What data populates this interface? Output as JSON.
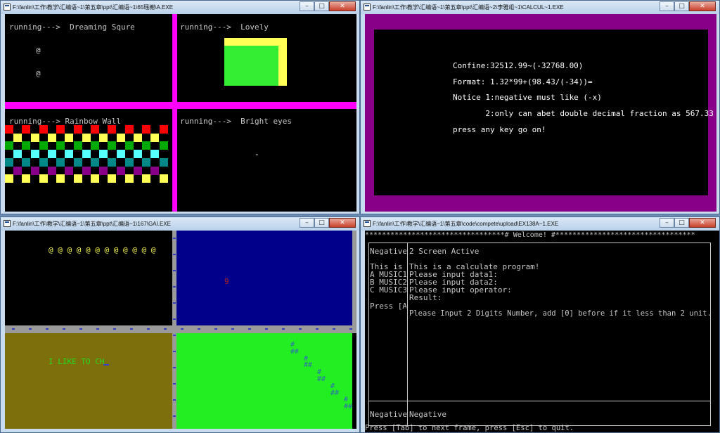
{
  "colors": {
    "magenta": "#ff00ff",
    "yellow": "#ffff55",
    "green": "#33ee33",
    "purple": "#880088",
    "navy": "#00008b",
    "olive": "#7d6f0c",
    "lime": "#22ee22"
  },
  "window_icons": {
    "minimize": "minimize-icon",
    "restore": "restore-icon",
    "close": "close-icon"
  },
  "win1": {
    "title": "F:\\fanlin\\工作\\教学\\汇编语~1\\第五章\\ppt\\汇编语~1\\65瑶榭\\A.EXE",
    "q1": {
      "label": "running--->  Dreaming Squre",
      "char1": "@",
      "char2": "@"
    },
    "q2": {
      "label": "running--->  Lovely"
    },
    "q3": {
      "label": "running---> Rainbow Wall"
    },
    "q4": {
      "label": "running--->  Bright eyes",
      "eye": "-"
    }
  },
  "win2": {
    "title": "F:\\fanlin\\工作\\教学\\汇编语~1\\第五章\\ppt\\汇编语~2\\李雅组~1\\CALCUL~1.EXE",
    "lines": [
      "Confine:32512.99~(-32768.00)",
      "Format: 1.32*99+(98.43/(-34))=",
      "Notice 1:negative must like (-x)",
      "       2:only can abet double decimal fraction as 567.33",
      "press any key go on!"
    ]
  },
  "win3": {
    "title": "F:\\fanlin\\工作\\教学\\汇编语~1\\第五章\\ppt\\汇编语~1\\167\\GAI.EXE",
    "at_row": "@ @ @ @ @ @ @ @ @ @ @ @",
    "blue_char": "9",
    "olive_text": "I LIKE TO CH",
    "hash_lines": [
      "#",
      "##",
      "#",
      "##",
      "#",
      "##",
      "#",
      "##",
      "#",
      "##",
      "#",
      "##"
    ]
  },
  "win4": {
    "title": "F:\\fanlin\\工作\\教学\\汇编语~1\\第五章\\code\\compete\\upload\\EX138A~1.EXE",
    "header": "*********************************# Welcome! #*********************************",
    "left_col": [
      "Negative",
      "",
      "This is",
      "A MUSIC1",
      "B MUSIC2",
      "C MUSIC3",
      "",
      "Press [A"
    ],
    "right_col": [
      "2 Screen Active",
      "",
      "This is a calculate program!",
      "Please input data1:",
      "Please input data2:",
      "Please input operator:",
      "Result:",
      "",
      "Please Input 2 Digits Number, add [0] before if it less than 2 unit."
    ],
    "bottom_left": "Negative",
    "bottom_right": "Negative",
    "footer": "Press [Tab] to next frame, press [Esc] to quit."
  }
}
